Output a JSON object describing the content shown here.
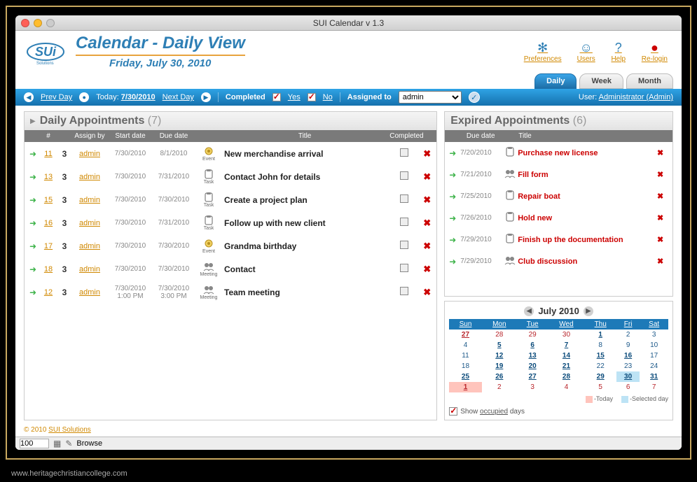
{
  "window_title": "SUI Calendar v 1.3",
  "header": {
    "title": "Calendar - Daily View",
    "date": "Friday, July 30, 2010",
    "top_links": {
      "preferences": "Preferences",
      "users": "Users",
      "help": "Help",
      "relogin": "Re-login"
    },
    "view_tabs": {
      "daily": "Daily",
      "week": "Week",
      "month": "Month"
    }
  },
  "toolbar": {
    "prev": "Prev Day",
    "today_prefix": "Today:",
    "today_date": "7/30/2010",
    "next": "Next Day",
    "completed": "Completed",
    "yes": "Yes",
    "no": "No",
    "assigned": "Assigned to",
    "assigned_value": "admin",
    "user_prefix": "User:",
    "user": "Administrator (Admin)"
  },
  "daily": {
    "title": "Daily Appointments",
    "count": "(7)",
    "cols": {
      "num": "#",
      "assign": "Assign by",
      "sdate": "Start date",
      "ddate": "Due date",
      "title": "Title",
      "comp": "Completed"
    },
    "rows": [
      {
        "num": "11",
        "pri": "3",
        "assign": "admin",
        "sdate": "7/30/2010",
        "ddate": "8/1/2010",
        "type": "Event",
        "title": "New merchandise arrival"
      },
      {
        "num": "13",
        "pri": "3",
        "assign": "admin",
        "sdate": "7/30/2010",
        "ddate": "7/31/2010",
        "type": "Task",
        "title": "Contact John for details"
      },
      {
        "num": "15",
        "pri": "3",
        "assign": "admin",
        "sdate": "7/30/2010",
        "ddate": "7/30/2010",
        "type": "Task",
        "title": "Create a project plan"
      },
      {
        "num": "16",
        "pri": "3",
        "assign": "admin",
        "sdate": "7/30/2010",
        "ddate": "7/31/2010",
        "type": "Task",
        "title": "Follow up with new client"
      },
      {
        "num": "17",
        "pri": "3",
        "assign": "admin",
        "sdate": "7/30/2010",
        "ddate": "7/30/2010",
        "type": "Event",
        "title": "Grandma birthday"
      },
      {
        "num": "18",
        "pri": "3",
        "assign": "admin",
        "sdate": "7/30/2010",
        "ddate": "7/30/2010",
        "type": "Meeting",
        "title": "Contact"
      },
      {
        "num": "12",
        "pri": "3",
        "assign": "admin",
        "sdate": "7/30/2010",
        "stime": "1:00 PM",
        "ddate": "7/30/2010",
        "dtime": "3:00 PM",
        "type": "Meeting",
        "title": "Team meeting"
      }
    ]
  },
  "expired": {
    "title": "Expired Appointments",
    "count": "(6)",
    "cols": {
      "ddate": "Due date",
      "title": "Title"
    },
    "rows": [
      {
        "date": "7/20/2010",
        "title": "Purchase new license",
        "type": "Task"
      },
      {
        "date": "7/21/2010",
        "title": "Fill form",
        "type": "Meeting"
      },
      {
        "date": "7/25/2010",
        "title": "Repair boat",
        "type": "Task"
      },
      {
        "date": "7/26/2010",
        "title": "Hold new",
        "type": "Task"
      },
      {
        "date": "7/29/2010",
        "title": "Finish up the documentation",
        "type": "Task"
      },
      {
        "date": "7/29/2010",
        "title": "Club discussion",
        "type": "Meeting"
      }
    ]
  },
  "calendar": {
    "month": "July  2010",
    "days": [
      "Sun",
      "Mon",
      "Tue",
      "Wed",
      "Thu",
      "Fri",
      "Sat"
    ],
    "grid": [
      [
        {
          "d": "27",
          "o": true,
          "b": true
        },
        {
          "d": "28",
          "o": true
        },
        {
          "d": "29",
          "o": true
        },
        {
          "d": "30",
          "o": true
        },
        {
          "d": "1",
          "b": true
        },
        {
          "d": "2"
        },
        {
          "d": "3"
        }
      ],
      [
        {
          "d": "4"
        },
        {
          "d": "5",
          "b": true
        },
        {
          "d": "6",
          "b": true
        },
        {
          "d": "7",
          "b": true
        },
        {
          "d": "8"
        },
        {
          "d": "9"
        },
        {
          "d": "10"
        }
      ],
      [
        {
          "d": "11"
        },
        {
          "d": "12",
          "b": true
        },
        {
          "d": "13",
          "b": true
        },
        {
          "d": "14",
          "b": true
        },
        {
          "d": "15",
          "b": true
        },
        {
          "d": "16",
          "b": true
        },
        {
          "d": "17"
        }
      ],
      [
        {
          "d": "18"
        },
        {
          "d": "19",
          "b": true
        },
        {
          "d": "20",
          "b": true
        },
        {
          "d": "21",
          "b": true
        },
        {
          "d": "22"
        },
        {
          "d": "23"
        },
        {
          "d": "24"
        }
      ],
      [
        {
          "d": "25",
          "b": true
        },
        {
          "d": "26",
          "b": true
        },
        {
          "d": "27",
          "b": true
        },
        {
          "d": "28",
          "b": true
        },
        {
          "d": "29",
          "b": true
        },
        {
          "d": "30",
          "b": true,
          "sel": true
        },
        {
          "d": "31",
          "b": true
        }
      ],
      [
        {
          "d": "1",
          "o": true,
          "b": true,
          "today": true
        },
        {
          "d": "2",
          "o": true
        },
        {
          "d": "3",
          "o": true
        },
        {
          "d": "4",
          "o": true
        },
        {
          "d": "5",
          "o": true
        },
        {
          "d": "6",
          "o": true
        },
        {
          "d": "7",
          "o": true
        }
      ]
    ],
    "legend_today": "-Today",
    "legend_sel": "-Selected day",
    "show_occupied": "Show occupied days"
  },
  "footer": {
    "copyright": "© 2010 ",
    "link": "SUI Solutions"
  },
  "statusbar": {
    "zoom": "100",
    "mode": "Browse"
  },
  "bottom_url": "www.heritagechristiancollege.com"
}
